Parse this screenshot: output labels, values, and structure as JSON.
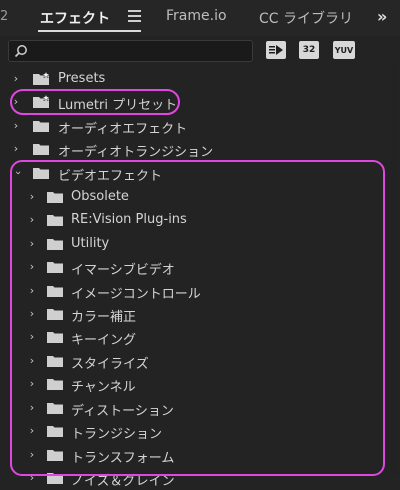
{
  "tabs": {
    "stub": "2",
    "effects": "エフェクト",
    "frameio": "Frame.io",
    "cc_library": "CC ライブラリ",
    "overflow": "»"
  },
  "toolbar": {
    "search_value": "",
    "accelerated": "",
    "bit32": "32",
    "yuv": "YUV"
  },
  "tree": {
    "presets": "Presets",
    "lumetri": "Lumetri プリセット",
    "audio_effects": "オーディオエフェクト",
    "audio_transitions": "オーディオトランジション",
    "video_effects": "ビデオエフェクト",
    "children": [
      "Obsolete",
      "RE:Vision Plug-ins",
      "Utility",
      "イマーシブビデオ",
      "イメージコントロール",
      "カラー補正",
      "キーイング",
      "スタイライズ",
      "チャンネル",
      "ディストーション",
      "トランジション",
      "トランスフォーム",
      "ノイズ＆グレイン"
    ]
  },
  "colors": {
    "highlight": "#e047e0",
    "folder": "#cfcfcf"
  }
}
